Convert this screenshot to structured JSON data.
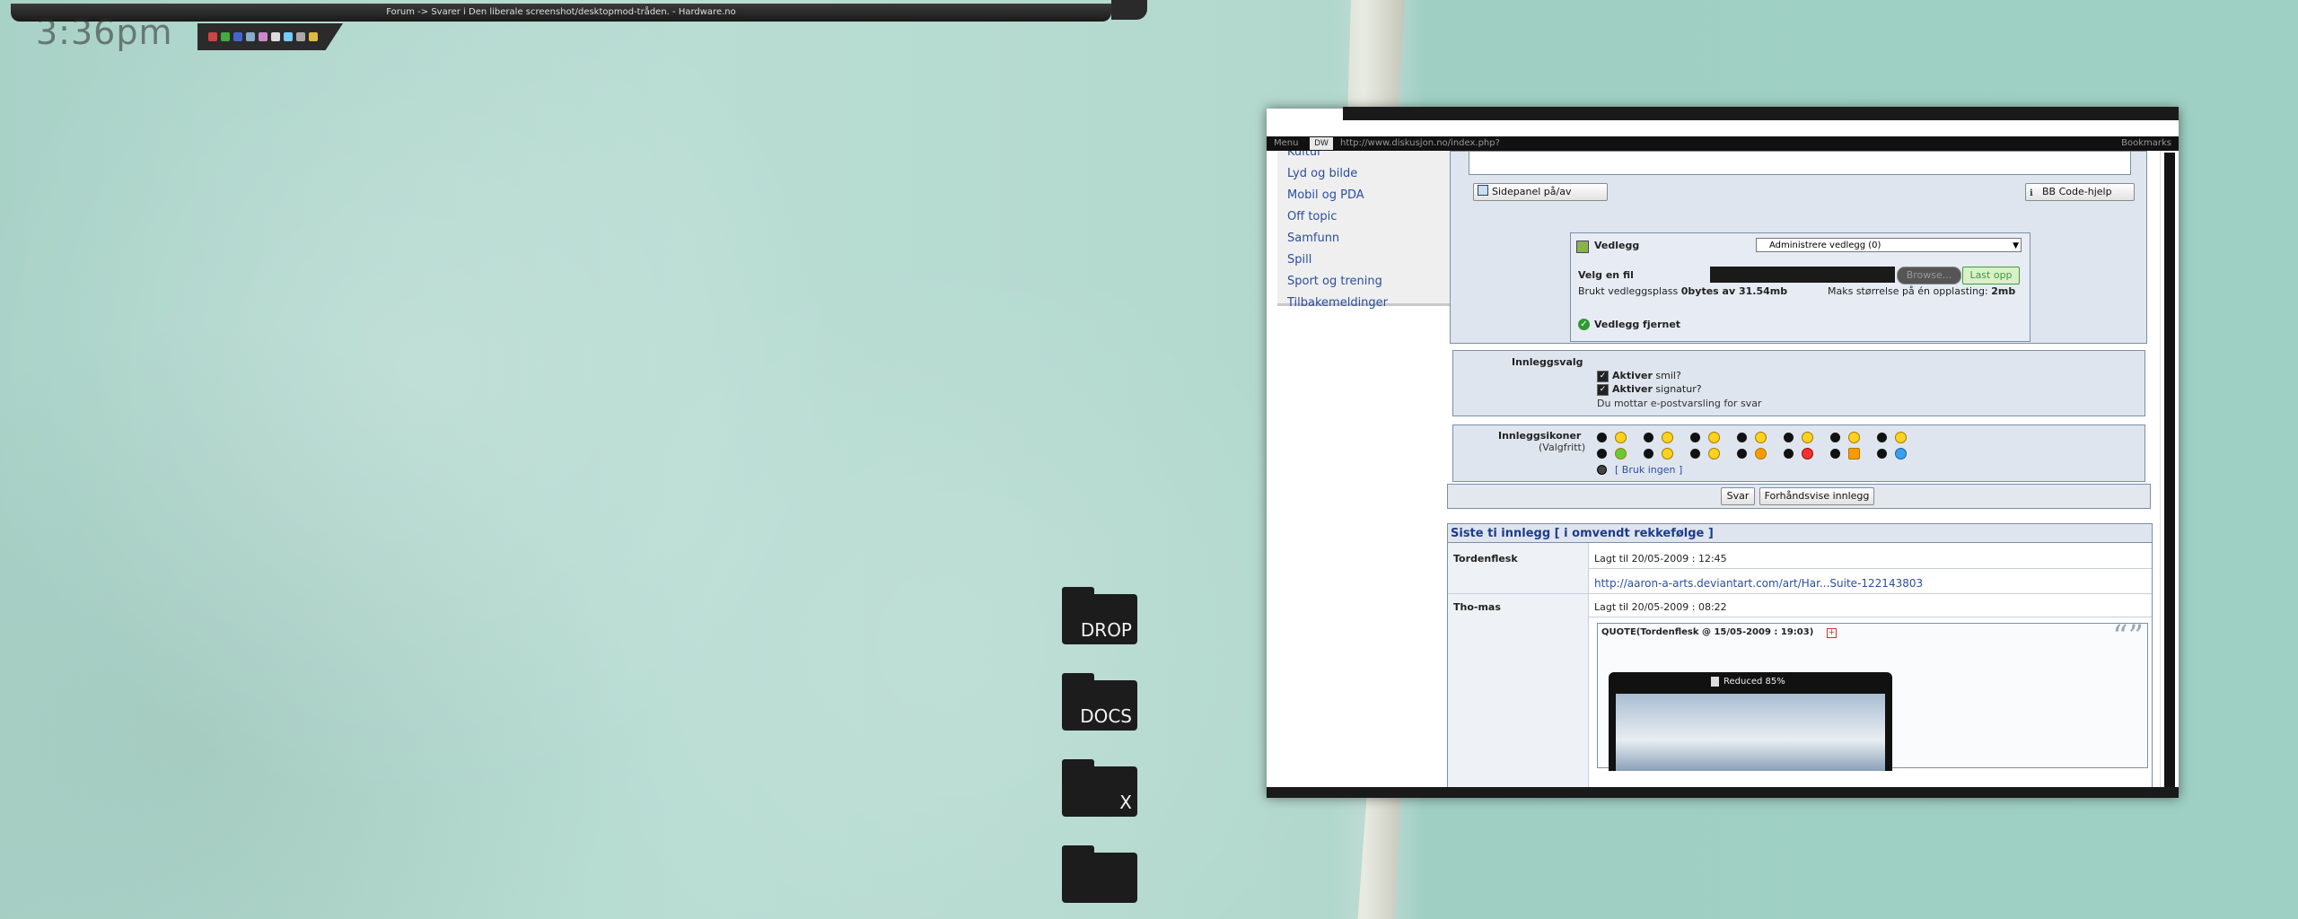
{
  "desktop": {
    "clock": "3:36pm",
    "topbar_title": "Forum -> Svarer i Den liberale screenshot/desktopmod-tråden. - Hardware.no",
    "folders": [
      "DROP",
      "DOCS",
      "X",
      ""
    ]
  },
  "browser": {
    "menu": "Menu",
    "logo": "DW",
    "url": "http://www.diskusjon.no/index.php?",
    "bookmarks": "Bookmarks",
    "sidebar": [
      "Kultur",
      "Lyd og bilde",
      "Mobil og PDA",
      "Off topic",
      "Samfunn",
      "Spill",
      "Sport og trening",
      "Tilbakemeldinger"
    ],
    "editor": {
      "sidepanel_button": "Sidepanel på/av",
      "bbcode_button": "BB Code-hjelp"
    },
    "attachments": {
      "title": "Vedlegg",
      "select_value": "Administrere vedlegg (0)",
      "choose_file": "Velg en fil",
      "browse": "Browse...",
      "upload": "Last opp",
      "used_label": "Brukt vedleggsplass",
      "used_value": "0bytes av 31.54mb",
      "max_label": "Maks størrelse på én opplasting:",
      "max_value": "2mb",
      "removed": "Vedlegg fjernet"
    },
    "post_options": {
      "title": "Innleggsvalg",
      "opt1_bold": "Aktiver",
      "opt1_rest": "smil?",
      "opt2_bold": "Aktiver",
      "opt2_rest": "signatur?",
      "notify": "Du mottar e-postvarsling for svar"
    },
    "post_icons": {
      "title": "Innleggsikoner",
      "subtitle": "(Valgfritt)",
      "none": "[ Bruk ingen ]"
    },
    "buttons": {
      "reply": "Svar",
      "preview": "Forhåndsvise innlegg"
    },
    "last_posts": {
      "header": "Siste ti innlegg [ i omvendt rekkefølge ]",
      "posts": [
        {
          "author": "Tordenflesk",
          "meta": "Lagt til 20/05-2009 : 12:45",
          "body": "http://aaron-a-arts.deviantart.com/art/Har...Suite-122143803"
        },
        {
          "author": "Tho-mas",
          "meta": "Lagt til 20/05-2009 : 08:22",
          "body": ""
        }
      ],
      "quote_header": "QUOTE(Tordenflesk @ 15/05-2009 : 19:03)",
      "reduced": "Reduced 85%"
    }
  },
  "colors": {
    "link": "#2a4e9e",
    "panel_bg": "#dfe5ee",
    "panel_border": "#7d8fa6",
    "upload_green": "#3e9a3e"
  }
}
